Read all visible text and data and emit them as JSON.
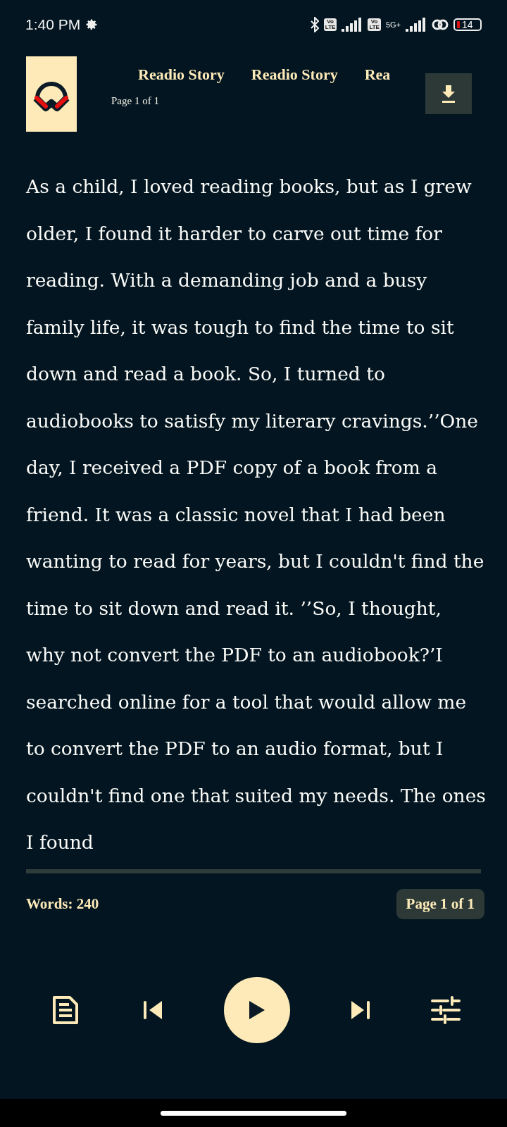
{
  "status_bar": {
    "time": "1:40 PM",
    "sim_badges": [
      "Vo\nLTE",
      "Vo\nLTE"
    ],
    "network": "5G+",
    "battery": "14"
  },
  "header": {
    "marquee": [
      "Readio Story",
      "Readio Story",
      "Rea"
    ],
    "page": "Page 1 of 1"
  },
  "body": "As a child, I loved reading books, but as I grew older, I found it harder to carve out time for reading. With a demanding job and a busy family life, it was tough to find the time to sit down and read a book. So, I turned to audiobooks to satisfy my literary cravings.’’One day, I received a PDF copy of a book from a friend. It was a classic novel that I had been wanting to read for years, but I couldn't find the time to sit down and read it. ’’So, I thought, why not convert the PDF to an audiobook?’I searched online for a tool that would allow me to convert the PDF to an audio format, but I couldn't find one that suited my needs. The ones I found",
  "footer": {
    "words": "Words: 240",
    "page": "Page 1 of 1"
  },
  "player": {
    "playing": false
  }
}
